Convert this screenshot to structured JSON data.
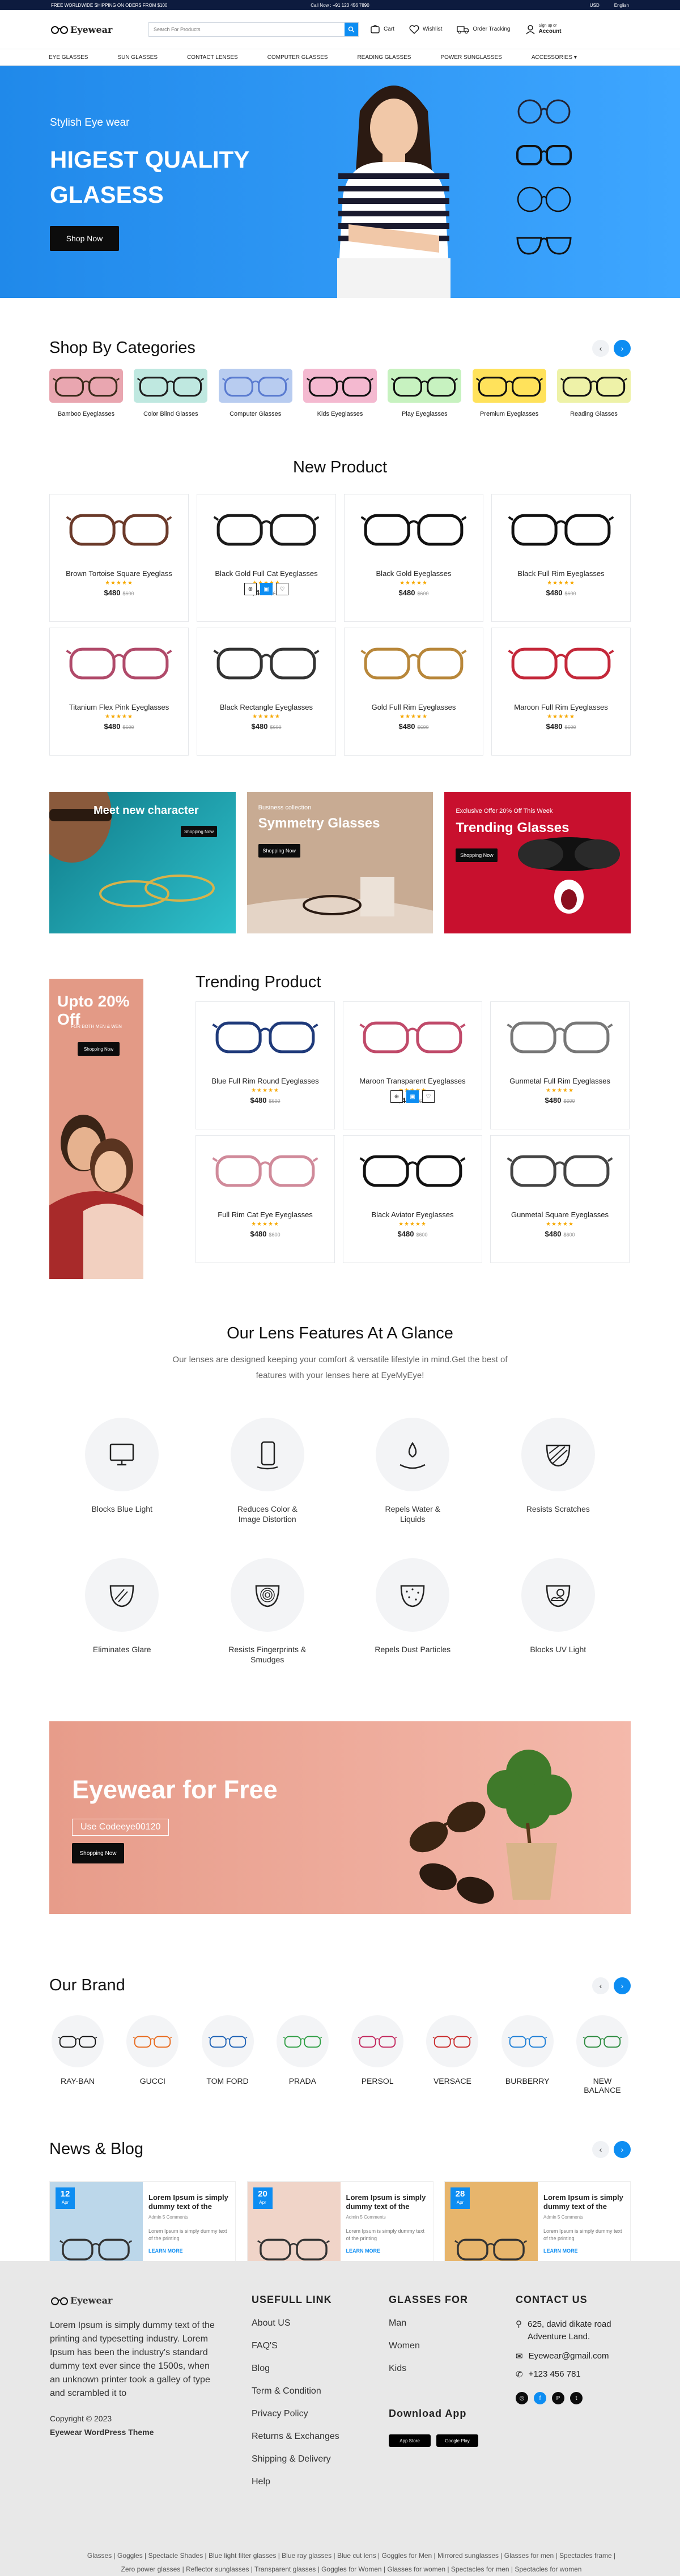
{
  "topbar": {
    "shipping": "FREE WORLDWIDE SHIPPING ON ODERS FROM $100",
    "call": "Call Now : +91 123 456 7890",
    "currency": "USD",
    "language": "English"
  },
  "header": {
    "logo": "Eyewear",
    "search_placeholder": "Search For Products",
    "cart": "Cart",
    "wishlist": "Wishlist",
    "order_tracking": "Order Tracking",
    "account_hint": "Sign up or",
    "account": "Account"
  },
  "nav": [
    "EYE GLASSES",
    "SUN GLASSES",
    "CONTACT LENSES",
    "COMPUTER GLASSES",
    "READING GLASSES",
    "POWER SUNGLASSES",
    "ACCESSORIES"
  ],
  "hero": {
    "tagline": "Stylish Eye wear",
    "headline": "HIGEST QUALITY GLASESS",
    "button": "Shop Now"
  },
  "categories": {
    "title": "Shop By Categories",
    "items": [
      {
        "label": "Bamboo Eyeglasses",
        "color": "#e9a6b0",
        "frame": "#3a2a1a"
      },
      {
        "label": "Color Blind Glasses",
        "color": "#bfe8e0",
        "frame": "#1f1f1f"
      },
      {
        "label": "Computer Glasses",
        "color": "#b8ccf0",
        "frame": "#5a7bd0"
      },
      {
        "label": "Kids Eyeglasses",
        "color": "#f4b9d0",
        "frame": "#111111"
      },
      {
        "label": "Play Eyeglasses",
        "color": "#c7f2c0",
        "frame": "#111111"
      },
      {
        "label": "Premium Eyeglasses",
        "color": "#ffe25b",
        "frame": "#111111"
      },
      {
        "label": "Reading Glasses",
        "color": "#eef2a8",
        "frame": "#111111"
      }
    ]
  },
  "new_product": {
    "title": "New Product",
    "items": [
      {
        "name": "Brown Tortoise Square Eyeglass",
        "stars": "★★★★★",
        "price": "$480",
        "old": "$600",
        "frame": "#6b3a2a"
      },
      {
        "name": "Black Gold Full Cat Eyeglasses",
        "stars": "★★★★★",
        "price": "$480",
        "old": "$600",
        "frame": "#1a1a1a"
      },
      {
        "name": "Black Gold Eyeglasses",
        "stars": "★★★★★",
        "price": "$480",
        "old": "$600",
        "frame": "#111111"
      },
      {
        "name": "Black Full Rim Eyeglasses",
        "stars": "★★★★★",
        "price": "$480",
        "old": "$600",
        "frame": "#111111"
      },
      {
        "name": "Titanium Flex Pink Eyeglasses",
        "stars": "★★★★★",
        "price": "$480",
        "old": "$600",
        "frame": "#b04a6a"
      },
      {
        "name": "Black Rectangle Eyeglasses",
        "stars": "★★★★★",
        "price": "$480",
        "old": "$600",
        "frame": "#333333"
      },
      {
        "name": "Gold Full Rim Eyeglasses",
        "stars": "★★★★★",
        "price": "$480",
        "old": "$600",
        "frame": "#b8873a"
      },
      {
        "name": "Maroon Full Rim Eyeglasses",
        "stars": "★★★★★",
        "price": "$480",
        "old": "$600",
        "frame": "#c4283a"
      }
    ]
  },
  "banners": [
    {
      "small": "",
      "title": "Meet  new character",
      "button": "Shopping Now"
    },
    {
      "small": "Business collection",
      "title": "Symmetry Glasses",
      "button": "Shopping Now"
    },
    {
      "small": "Exclusive Offer 20% Off This Week",
      "title": "Trending Glasses",
      "button": "Shopping Now"
    }
  ],
  "trending": {
    "title": "Trending Product",
    "side_offer": "Upto 20% Off",
    "side_sub": "FOR BOTH MEN & WEN",
    "side_button": "Shopping Now",
    "items": [
      {
        "name": "Blue Full Rim Round Eyeglasses",
        "stars": "★★★★★",
        "price": "$480",
        "old": "$600",
        "frame": "#1f3a7a"
      },
      {
        "name": "Maroon Transparent Eyeglasses",
        "stars": "★★★★★",
        "price": "$480",
        "old": "$600",
        "frame": "#c04a6a"
      },
      {
        "name": "Gunmetal Full Rim Eyeglasses",
        "stars": "★★★★★",
        "price": "$480",
        "old": "$600",
        "frame": "#777777"
      },
      {
        "name": "Full Rim Cat Eye Eyeglasses",
        "stars": "★★★★★",
        "price": "$480",
        "old": "$600",
        "frame": "#d08a9a"
      },
      {
        "name": "Black Aviator Eyeglasses",
        "stars": "★★★★★",
        "price": "$480",
        "old": "$600",
        "frame": "#111111"
      },
      {
        "name": "Gunmetal Square Eyeglasses",
        "stars": "★★★★★",
        "price": "$480",
        "old": "$600",
        "frame": "#444444"
      }
    ]
  },
  "features": {
    "title": "Our Lens Features At A Glance",
    "subtitle": "Our lenses are designed keeping your comfort & versatile lifestyle in mind.Get the best of features with your lenses here at EyeMyEye!",
    "items": [
      {
        "label": "Blocks Blue Light",
        "icon": "monitor-icon"
      },
      {
        "label": "Reduces Color & Image Distortion",
        "icon": "phone-icon"
      },
      {
        "label": "Repels Water & Liquids",
        "icon": "water-drops-icon"
      },
      {
        "label": "Resists Scratches",
        "icon": "scratch-icon"
      },
      {
        "label": "Eliminates Glare",
        "icon": "glare-icon"
      },
      {
        "label": "Resists Fingerprints & Smudges",
        "icon": "fingerprint-icon"
      },
      {
        "label": "Repels Dust Particles",
        "icon": "dust-icon"
      },
      {
        "label": "Blocks UV Light",
        "icon": "sun-cloud-icon"
      }
    ]
  },
  "promo": {
    "title": "Eyewear for Free",
    "code": "Use Codeeye00120",
    "button": "Shopping Now"
  },
  "brands": {
    "title": "Our Brand",
    "items": [
      "RAY-BAN",
      "GUCCI",
      "TOM FORD",
      "PRADA",
      "PERSOL",
      "VERSACE",
      "BURBERRY",
      "NEW BALANCE"
    ]
  },
  "blog": {
    "title": "News & Blog",
    "posts": [
      {
        "day": "12",
        "month": "Apr",
        "title": "Lorem Ipsum is simply dummy text of the",
        "author": "Admin",
        "comments": "5 Comments",
        "desc": "Lorem Ipsum is simply dummy text of the printing",
        "more": "LEARN MORE"
      },
      {
        "day": "20",
        "month": "Apr",
        "title": "Lorem Ipsum is simply dummy text of the",
        "author": "Admin",
        "comments": "5 Comments",
        "desc": "Lorem Ipsum is simply dummy text of the printing",
        "more": "LEARN MORE"
      },
      {
        "day": "28",
        "month": "Apr",
        "title": "Lorem Ipsum is simply dummy text of the",
        "author": "Admin",
        "comments": "5 Comments",
        "desc": "Lorem Ipsum is simply dummy text of the printing",
        "more": "LEARN MORE"
      }
    ]
  },
  "footer": {
    "logo": "Eyewear",
    "about": "Lorem Ipsum is simply dummy text of the printing and typesetting industry. Lorem Ipsum has been the industry's standard dummy text ever since the 1500s, when an unknown printer took a galley of type and scrambled it to",
    "copyright": "Copyright © 2023",
    "theme": "Eyewear WordPress Theme",
    "useful_title": "USEFULL LINK",
    "useful": [
      "About US",
      "FAQ'S",
      "Blog",
      "Term & Condition",
      "Privacy Policy",
      "Returns & Exchanges",
      "Shipping & Delivery",
      "Help"
    ],
    "glasses_title": "GLASSES FOR",
    "glasses": [
      "Man",
      "Women",
      "Kids"
    ],
    "contact_title": "CONTACT US",
    "address": "625, david dikate road Adventure Land.",
    "email": "Eyewear@gmail.com",
    "phone": "+123 456 781",
    "app_title": "Download App",
    "app_store": "App Store",
    "google_play": "Google Play",
    "tags": "Glasses | Goggles | Spectacle Shades | Blue light filter glasses | Blue ray glasses | Blue cut lens | Goggles for Men | Mirrored sunglasses | Glasses for men | Spectacles frame | Zero power glasses | Reflector sunglasses | Transparent glasses | Goggles for Women | Glasses for women | Spectacles for men | Spectacles for women"
  }
}
